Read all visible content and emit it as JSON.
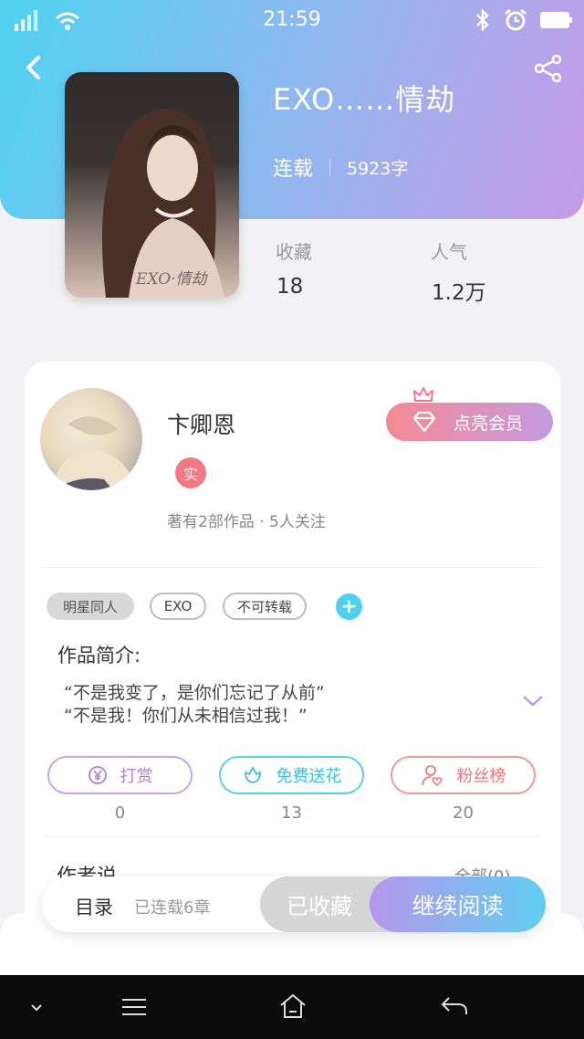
{
  "status_bar": {
    "time": "21:59"
  },
  "book": {
    "title": "EXO……情劫",
    "status": "连载",
    "word_count": "5923字",
    "cover_watermark": "EXO·情劫"
  },
  "stats": {
    "favorites_label": "收藏",
    "favorites_value": "18",
    "popularity_label": "人气",
    "popularity_value": "1.2万"
  },
  "author": {
    "name": "卞卿恩",
    "badge": "实",
    "info": "著有2部作品 · 5人关注",
    "vip_button": "点亮会员"
  },
  "tags": [
    "明星同人",
    "EXO",
    "不可转载"
  ],
  "intro": {
    "title": "作品简介:",
    "lines": [
      "“不是我变了，是你们忘记了从前”",
      "“不是我！你们从未相信过我！”"
    ]
  },
  "actions": [
    {
      "label": "打赏",
      "count": "0"
    },
    {
      "label": "免费送花",
      "count": "13"
    },
    {
      "label": "粉丝榜",
      "count": "20"
    }
  ],
  "author_say": {
    "title": "作者说",
    "all_link": "全部(0)"
  },
  "bottom_bar": {
    "toc_label": "目录",
    "toc_status": "已连载6章",
    "collected_label": "已收藏",
    "read_label": "继续阅读"
  },
  "colors": {
    "accent_cyan": "#4fd3f0",
    "accent_purple": "#c79ae8",
    "vip_pink": "#f58a94"
  }
}
